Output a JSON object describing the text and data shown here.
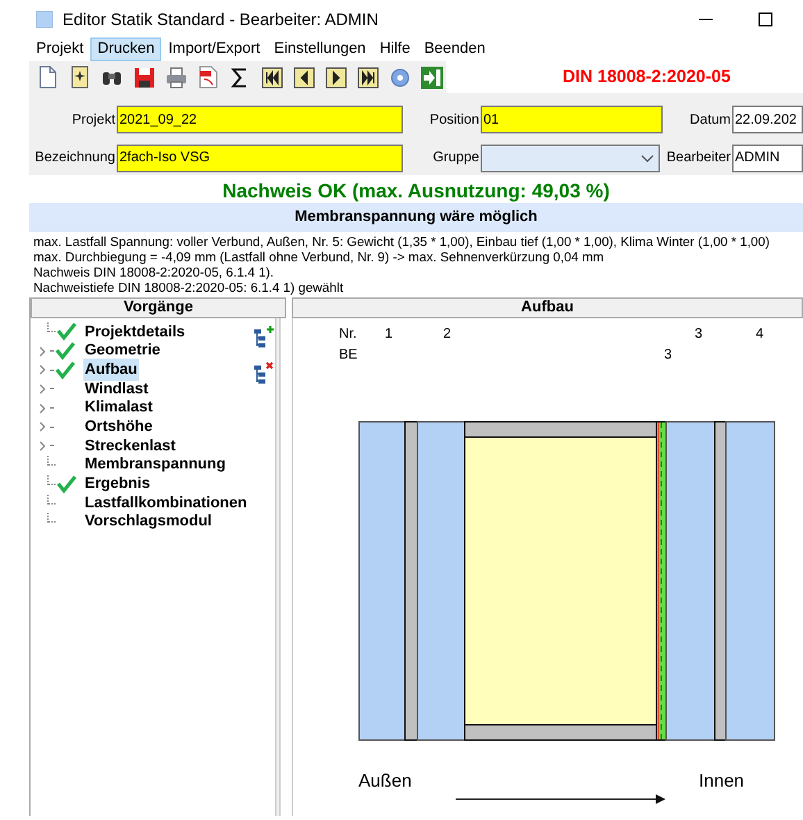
{
  "window": {
    "title": "Editor Statik Standard - Bearbeiter: ADMIN"
  },
  "menu": [
    {
      "label": "Projekt",
      "selected": false
    },
    {
      "label": "Drucken",
      "selected": true
    },
    {
      "label": "Import/Export",
      "selected": false
    },
    {
      "label": "Einstellungen",
      "selected": false
    },
    {
      "label": "Hilfe",
      "selected": false
    },
    {
      "label": "Beenden",
      "selected": false
    }
  ],
  "norm": "DIN 18008-2:2020-05",
  "form": {
    "projekt": {
      "label": "Projekt",
      "value": "2021_09_22"
    },
    "position": {
      "label": "Position",
      "value": "01"
    },
    "datum": {
      "label": "Datum",
      "value": "22.09.202"
    },
    "bezeichnung": {
      "label": "Bezeichnung",
      "value": "2fach-Iso VSG"
    },
    "gruppe": {
      "label": "Gruppe"
    },
    "bearbeiter": {
      "label": "Bearbeiter",
      "value": "ADMIN"
    }
  },
  "result": "Nachweis OK (max. Ausnutzung: 49,03 %)",
  "banner": "Membranspannung wäre möglich",
  "info_lines": [
    "max. Lastfall Spannung: voller Verbund, Außen, Nr. 5:  Gewicht (1,35 * 1,00), Einbau tief (1,00 * 1,00), Klima Winter (1,00 * 1,00)",
    "max. Durchbiegung = -4,09 mm (Lastfall ohne Verbund, Nr. 9) -> max. Sehnenverkürzung 0,04 mm",
    "Nachweis DIN 18008-2:2020-05, 6.1.4 1).",
    "Nachweistiefe DIN 18008-2:2020-05: 6.1.4 1) gewählt"
  ],
  "tree": {
    "title": "Vorgänge",
    "items": [
      {
        "label": "Projektdetails",
        "checked": true,
        "expandable": false,
        "selected": false
      },
      {
        "label": "Geometrie",
        "checked": true,
        "expandable": true,
        "selected": false
      },
      {
        "label": "Aufbau",
        "checked": true,
        "expandable": true,
        "selected": true
      },
      {
        "label": "Windlast",
        "checked": false,
        "expandable": true,
        "selected": false
      },
      {
        "label": "Klimalast",
        "checked": false,
        "expandable": true,
        "selected": false
      },
      {
        "label": "Ortshöhe",
        "checked": false,
        "expandable": true,
        "selected": false
      },
      {
        "label": "Streckenlast",
        "checked": false,
        "expandable": true,
        "selected": false
      },
      {
        "label": "Membranspannung",
        "checked": false,
        "expandable": false,
        "selected": false
      },
      {
        "label": "Ergebnis",
        "checked": true,
        "expandable": false,
        "selected": false
      },
      {
        "label": "Lastfallkombinationen",
        "checked": false,
        "expandable": false,
        "selected": false
      },
      {
        "label": "Vorschlagsmodul",
        "checked": false,
        "expandable": false,
        "selected": false
      }
    ]
  },
  "aufbau": {
    "title": "Aufbau",
    "nr_label": "Nr.",
    "nr": [
      "1",
      "2",
      "3",
      "4"
    ],
    "be_label": "BE",
    "be": [
      "3"
    ],
    "outside": "Außen",
    "inside": "Innen"
  }
}
